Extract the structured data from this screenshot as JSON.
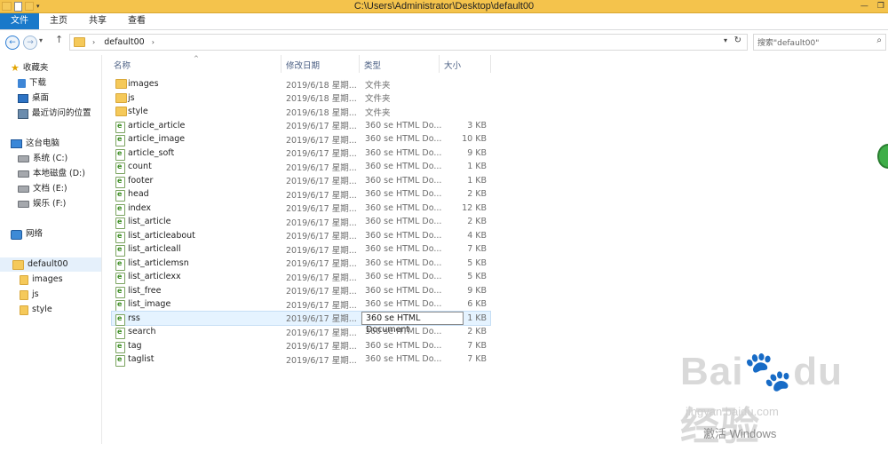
{
  "window": {
    "title": "C:\\Users\\Administrator\\Desktop\\default00"
  },
  "ribbon": {
    "tabs": [
      "文件",
      "主页",
      "共享",
      "查看"
    ]
  },
  "address": {
    "crumb": "default00",
    "separator": "›"
  },
  "search": {
    "placeholder": "搜索\"default00\""
  },
  "columns": {
    "name": "名称",
    "date": "修改日期",
    "type": "类型",
    "size": "大小"
  },
  "navpane": {
    "favorites": {
      "label": "收藏夹",
      "items": [
        "下载",
        "桌面",
        "最近访问的位置"
      ]
    },
    "pc": {
      "label": "这台电脑",
      "items": [
        "系统 (C:)",
        "本地磁盘 (D:)",
        "文档 (E:)",
        "娱乐 (F:)"
      ]
    },
    "network": {
      "label": "网络"
    },
    "tree": {
      "root": "default00",
      "children": [
        "images",
        "js",
        "style"
      ]
    }
  },
  "files": [
    {
      "name": "images",
      "date": "2019/6/18 星期...",
      "type": "文件夹",
      "size": "",
      "kind": "folder"
    },
    {
      "name": "js",
      "date": "2019/6/18 星期...",
      "type": "文件夹",
      "size": "",
      "kind": "folder"
    },
    {
      "name": "style",
      "date": "2019/6/18 星期...",
      "type": "文件夹",
      "size": "",
      "kind": "folder"
    },
    {
      "name": "article_article",
      "date": "2019/6/17 星期...",
      "type": "360 se HTML Do...",
      "size": "3 KB",
      "kind": "html"
    },
    {
      "name": "article_image",
      "date": "2019/6/17 星期...",
      "type": "360 se HTML Do...",
      "size": "10 KB",
      "kind": "html"
    },
    {
      "name": "article_soft",
      "date": "2019/6/17 星期...",
      "type": "360 se HTML Do...",
      "size": "9 KB",
      "kind": "html"
    },
    {
      "name": "count",
      "date": "2019/6/17 星期...",
      "type": "360 se HTML Do...",
      "size": "1 KB",
      "kind": "html"
    },
    {
      "name": "footer",
      "date": "2019/6/17 星期...",
      "type": "360 se HTML Do...",
      "size": "1 KB",
      "kind": "html"
    },
    {
      "name": "head",
      "date": "2019/6/17 星期...",
      "type": "360 se HTML Do...",
      "size": "2 KB",
      "kind": "html"
    },
    {
      "name": "index",
      "date": "2019/6/17 星期...",
      "type": "360 se HTML Do...",
      "size": "12 KB",
      "kind": "html"
    },
    {
      "name": "list_article",
      "date": "2019/6/17 星期...",
      "type": "360 se HTML Do...",
      "size": "2 KB",
      "kind": "html"
    },
    {
      "name": "list_articleabout",
      "date": "2019/6/17 星期...",
      "type": "360 se HTML Do...",
      "size": "4 KB",
      "kind": "html"
    },
    {
      "name": "list_articleall",
      "date": "2019/6/17 星期...",
      "type": "360 se HTML Do...",
      "size": "7 KB",
      "kind": "html"
    },
    {
      "name": "list_articlemsn",
      "date": "2019/6/17 星期...",
      "type": "360 se HTML Do...",
      "size": "5 KB",
      "kind": "html"
    },
    {
      "name": "list_articlexx",
      "date": "2019/6/17 星期...",
      "type": "360 se HTML Do...",
      "size": "5 KB",
      "kind": "html"
    },
    {
      "name": "list_free",
      "date": "2019/6/17 星期...",
      "type": "360 se HTML Do...",
      "size": "9 KB",
      "kind": "html"
    },
    {
      "name": "list_image",
      "date": "2019/6/17 星期...",
      "type": "360 se HTML Do...",
      "size": "6 KB",
      "kind": "html"
    },
    {
      "name": "rss",
      "date": "2019/6/17 星期...",
      "type": "360 se HTML Document",
      "size": "1 KB",
      "kind": "html",
      "selected": true
    },
    {
      "name": "search",
      "date": "2019/6/17 星期...",
      "type": "360 se HTML Do...",
      "size": "2 KB",
      "kind": "html"
    },
    {
      "name": "tag",
      "date": "2019/6/17 星期...",
      "type": "360 se HTML Do...",
      "size": "7 KB",
      "kind": "html"
    },
    {
      "name": "taglist",
      "date": "2019/6/17 星期...",
      "type": "360 se HTML Do...",
      "size": "7 KB",
      "kind": "html"
    }
  ],
  "watermark": {
    "logo": "Bai du 经验",
    "url": "jingyan.baidu.com",
    "activate": "激活 Windows"
  },
  "colors": {
    "titlebar": "#f4c34c",
    "file_tab": "#1979ca",
    "selected_row": "#e5f3ff"
  }
}
